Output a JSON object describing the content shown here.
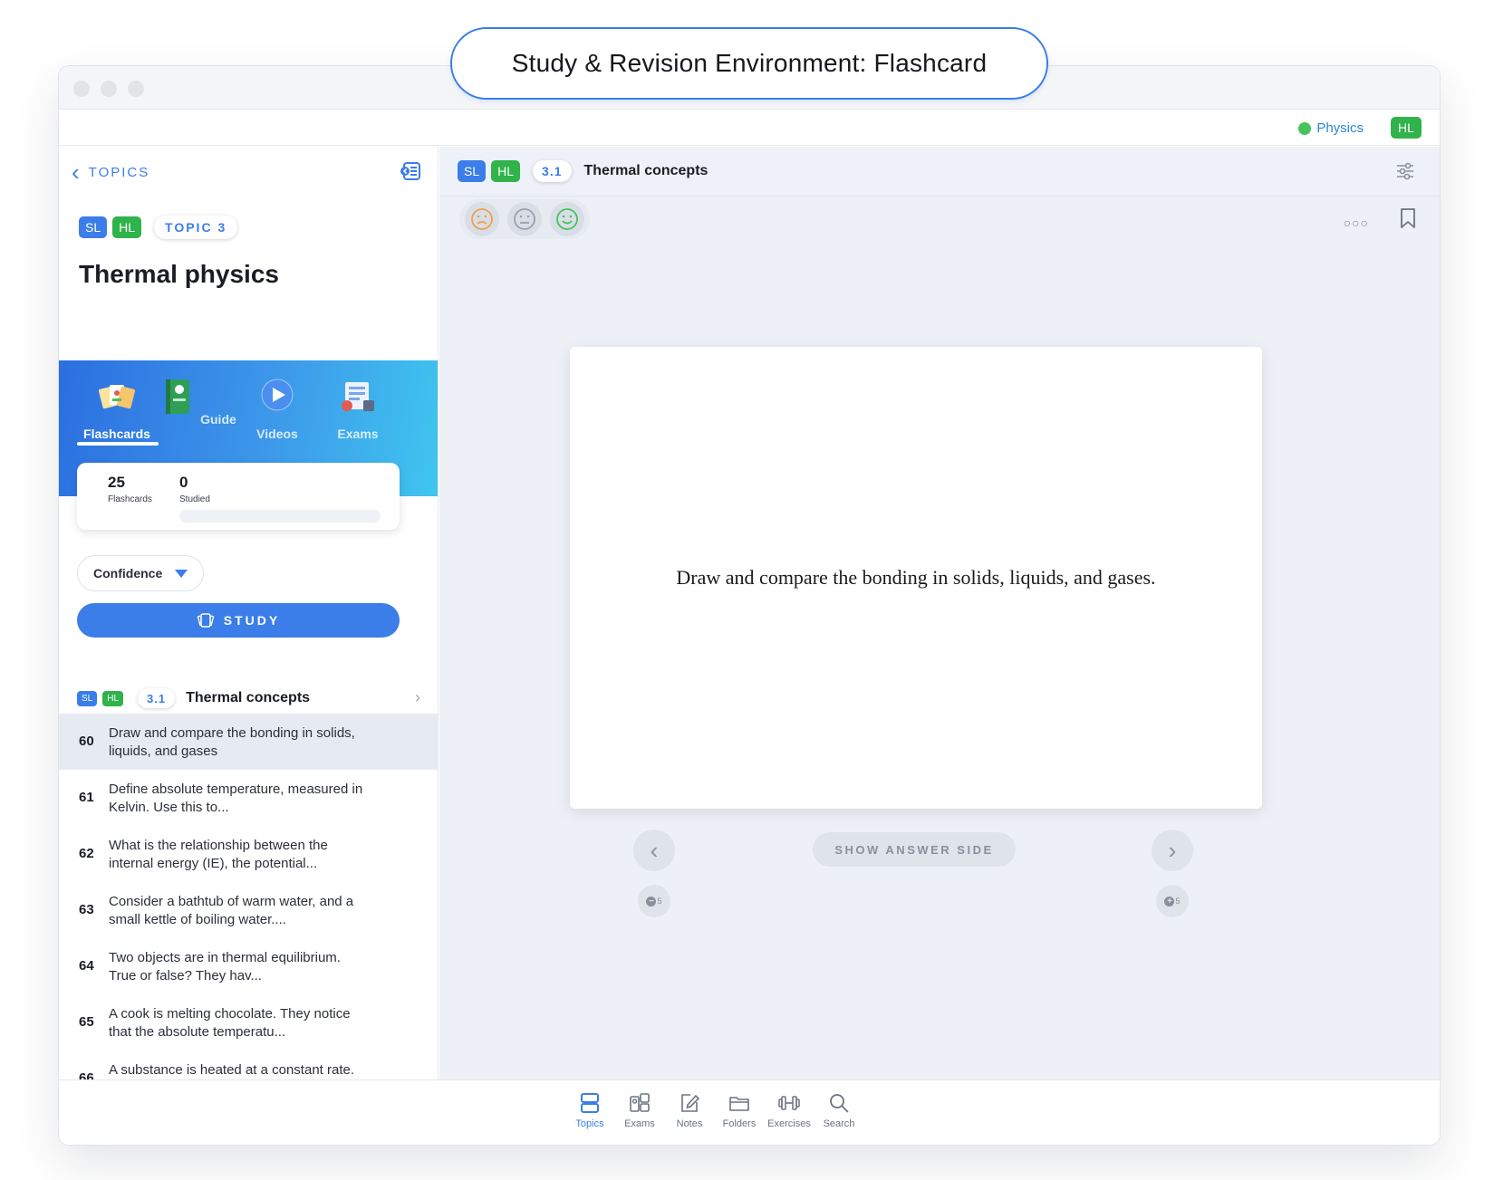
{
  "header_pill": "Study & Revision Environment: Flashcard",
  "appbar": {
    "subject": "Physics",
    "level": "HL"
  },
  "sidebar": {
    "back_label": "TOPICS",
    "badges": {
      "sl": "SL",
      "hl": "HL",
      "topic": "TOPIC 3"
    },
    "title": "Thermal physics",
    "modes": [
      {
        "label": "Flashcards",
        "icon": "flashcards-icon",
        "active": true
      },
      {
        "label": "Guide",
        "icon": "guide-icon",
        "active": false
      },
      {
        "label": "Videos",
        "icon": "videos-icon",
        "active": false
      },
      {
        "label": "Exams",
        "icon": "exams-icon",
        "active": false
      }
    ],
    "stats": {
      "flashcards_count": "25",
      "flashcards_label": "Flashcards",
      "studied_count": "0",
      "studied_label": "Studied",
      "progress_percent": 0
    },
    "filter_label": "Confidence",
    "study_label": "STUDY",
    "subtopic": {
      "sl": "SL",
      "hl": "HL",
      "number": "3.1",
      "title": "Thermal concepts"
    },
    "items": [
      {
        "num": "60",
        "text": "Draw and compare the bonding in solids, liquids, and gases",
        "active": true
      },
      {
        "num": "61",
        "text": "Define absolute temperature, measured in Kelvin. Use this to...",
        "active": false
      },
      {
        "num": "62",
        "text": "What is the relationship between the internal energy (IE), the potential...",
        "active": false
      },
      {
        "num": "63",
        "text": "Consider a bathtub of warm water, and a small kettle of boiling water....",
        "active": false
      },
      {
        "num": "64",
        "text": "Two objects are in thermal equilibrium. True or false? They hav...",
        "active": false
      },
      {
        "num": "65",
        "text": "A cook is melting chocolate. They notice that the absolute temperatu...",
        "active": false
      },
      {
        "num": "66",
        "text": "A substance is heated at a constant rate. Complete the graph of...",
        "active": false
      }
    ]
  },
  "main": {
    "badges": {
      "sl": "SL",
      "hl": "HL",
      "number": "3.1"
    },
    "title": "Thermal concepts",
    "moods": [
      "sad-face-icon",
      "neutral-face-icon",
      "happy-face-icon"
    ],
    "card_text": "Draw and compare the bonding in solids, liquids, and gases.",
    "show_answer_label": "SHOW ANSWER SIDE",
    "skip_back": "5",
    "skip_forward": "5"
  },
  "bottom_tabs": [
    {
      "label": "Topics",
      "icon": "topics-icon",
      "active": true
    },
    {
      "label": "Exams",
      "icon": "exams-tab-icon",
      "active": false
    },
    {
      "label": "Notes",
      "icon": "notes-icon",
      "active": false
    },
    {
      "label": "Folders",
      "icon": "folders-icon",
      "active": false
    },
    {
      "label": "Exercises",
      "icon": "exercises-icon",
      "active": false
    },
    {
      "label": "Search",
      "icon": "search-icon",
      "active": false
    }
  ],
  "colors": {
    "accent": "#3b7de9",
    "hl_green": "#2fb34a",
    "hero_gradient_start": "#2b6fe0",
    "hero_gradient_end": "#3fc6ef"
  }
}
